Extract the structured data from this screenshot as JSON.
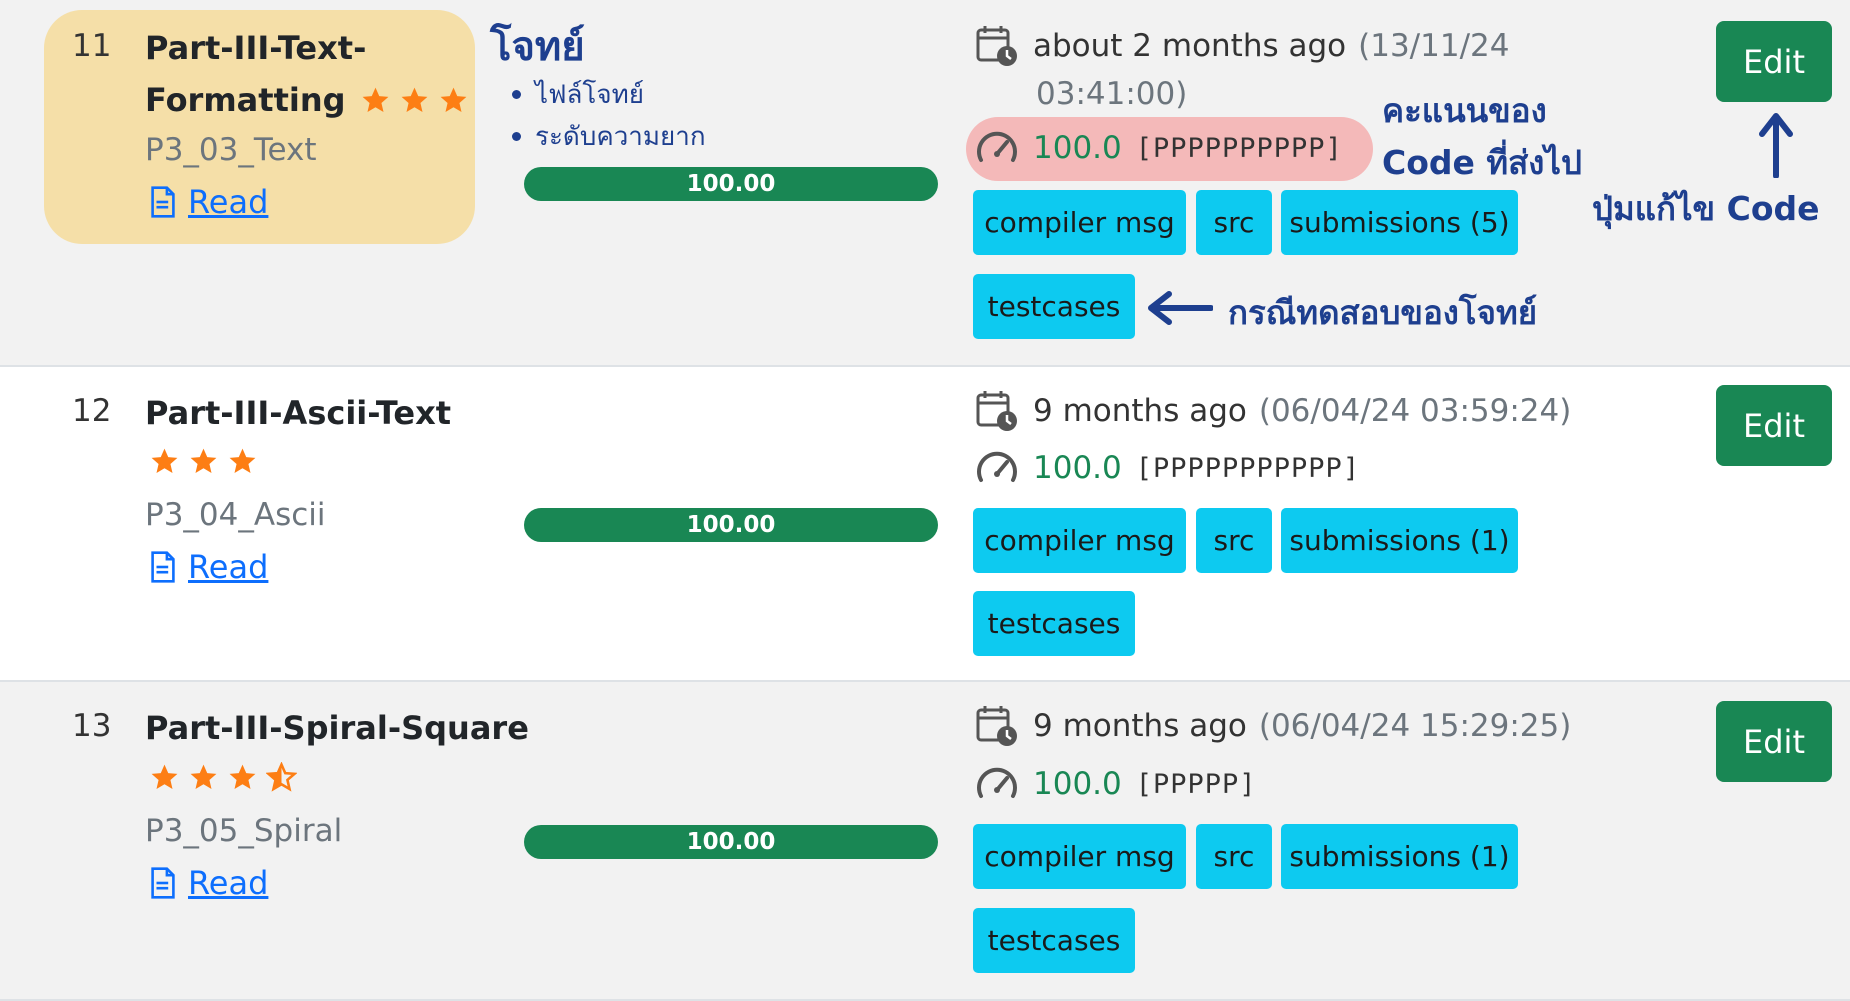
{
  "colors": {
    "edit_button": "#198754",
    "action_button": "#0dcaf0",
    "progress": "#198754",
    "star": "#fd7e14",
    "link": "#0d6efd",
    "annotation": "#1e3f8f",
    "problem_highlight": "#f5dfa8",
    "score_highlight": "#f4b9b9"
  },
  "annotations": {
    "problem_title": "โจทย์",
    "problem_items": [
      "ไฟล์โจทย์",
      "ระดับความยาก"
    ],
    "score_line1": "คะแนนของ",
    "score_line2": "Code ที่ส่งไป",
    "edit_label": "ปุ่มแก้ไข Code",
    "testcases_label": "กรณีทดสอบของโจทย์"
  },
  "rows": [
    {
      "num": "11",
      "title_line1": "Part-III-Text-",
      "title_line2": "Formatting",
      "stars": 3,
      "code": "P3_03_Text",
      "read": "Read",
      "progress": 100.0,
      "progress_label": "100.00",
      "time_rel": "about 2 months ago",
      "time_abs_line1": "(13/11/24",
      "time_abs_line2": "03:41:00)",
      "score": "100.0",
      "result": "[PPPPPPPPPP]",
      "buttons": {
        "compiler": "compiler msg",
        "src": "src",
        "submissions": "submissions (5)",
        "testcases": "testcases"
      },
      "edit": "Edit"
    },
    {
      "num": "12",
      "title": "Part-III-Ascii-Text",
      "stars": 3,
      "code": "P3_04_Ascii",
      "read": "Read",
      "progress": 100.0,
      "progress_label": "100.00",
      "time_rel": "9 months ago",
      "time_abs": "(06/04/24 03:59:24)",
      "score": "100.0",
      "result": "[PPPPPPPPPPP]",
      "buttons": {
        "compiler": "compiler msg",
        "src": "src",
        "submissions": "submissions (1)",
        "testcases": "testcases"
      },
      "edit": "Edit"
    },
    {
      "num": "13",
      "title": "Part-III-Spiral-Square",
      "stars": 3.5,
      "code": "P3_05_Spiral",
      "read": "Read",
      "progress": 100.0,
      "progress_label": "100.00",
      "time_rel": "9 months ago",
      "time_abs": "(06/04/24 15:29:25)",
      "score": "100.0",
      "result": "[PPPPP]",
      "buttons": {
        "compiler": "compiler msg",
        "src": "src",
        "submissions": "submissions (1)",
        "testcases": "testcases"
      },
      "edit": "Edit"
    }
  ]
}
